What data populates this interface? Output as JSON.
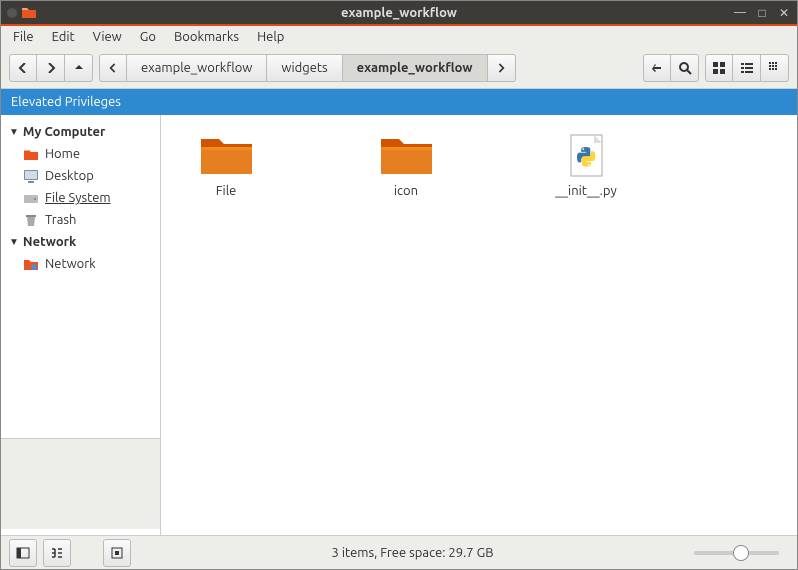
{
  "titlebar": {
    "title": "example_workflow"
  },
  "menubar": {
    "file": "File",
    "edit": "Edit",
    "view": "View",
    "go": "Go",
    "bookmarks": "Bookmarks",
    "help": "Help"
  },
  "breadcrumb": {
    "b0": "example_workflow",
    "b1": "widgets",
    "b2": "example_workflow"
  },
  "privbar": {
    "text": "Elevated Privileges"
  },
  "sidebar": {
    "mycomputer": "My Computer",
    "home": "Home",
    "desktop": "Desktop",
    "filesystem": "File System",
    "trash": "Trash",
    "network_section": "Network",
    "network": "Network"
  },
  "files": {
    "f0": "File",
    "f1": "icon",
    "f2": "__init__.py"
  },
  "statusbar": {
    "text": "3 items, Free space: 29.7 GB"
  }
}
